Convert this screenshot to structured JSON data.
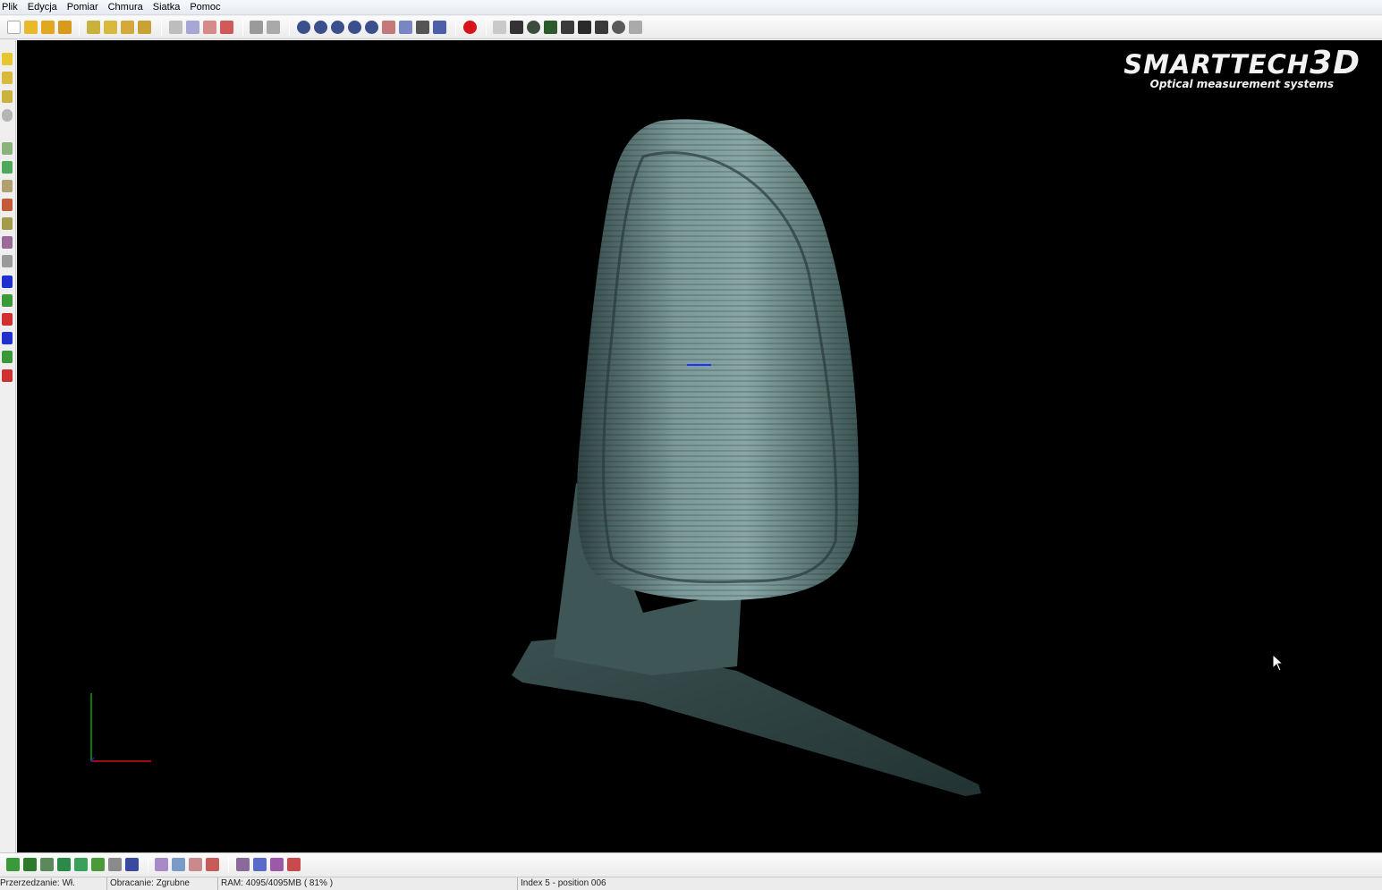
{
  "menu": [
    "Plik",
    "Edycja",
    "Pomiar",
    "Chmura",
    "Siatka",
    "Pomoc"
  ],
  "logo": {
    "brand": "SMARTTECH",
    "brand_suffix": "3D",
    "tagline": "Optical measurement systems"
  },
  "icons": {
    "top_toolbar": [
      "new-file-icon",
      "open-icon",
      "save-icon",
      "save-as-icon",
      "import-icon",
      "export-icon",
      "scan-icon",
      "merge-icon",
      "grid-select-icon",
      "rotate-select-icon",
      "select-all-icon",
      "delete-icon",
      "undo-icon",
      "redo-icon",
      "view-front-icon",
      "view-back-icon",
      "view-left-icon",
      "view-right-icon",
      "view-top-icon",
      "view-bottom-icon",
      "view-iso-icon",
      "perspective-icon",
      "zoom-fit-icon",
      "stop-icon",
      "power-icon",
      "camera-icon",
      "projector-icon",
      "calibrate-icon",
      "settings-icon",
      "film-icon",
      "network-icon",
      "sensor-icon"
    ],
    "left_toolbar": [
      "layer-icon",
      "layer-list-icon",
      "layer-edit-icon",
      "help-icon",
      "measure-point-icon",
      "measure-distance-icon",
      "measure-angle-icon",
      "measure-plane-icon",
      "measure-circle-icon",
      "measure-cylinder-icon",
      "measure-sphere-icon",
      "box-blue-icon",
      "box-wire-icon",
      "box-red-icon",
      "box-blue-2-icon",
      "box-wire-2-icon",
      "box-red-2-icon"
    ],
    "bottom_toolbar": [
      "mesh-green-icon",
      "mesh-smooth-icon",
      "mesh-filter-icon",
      "mesh-fill-icon",
      "mesh-decimate-icon",
      "mesh-arrow-icon",
      "mesh-cut-icon",
      "mesh-color-icon",
      "cloud-select-icon",
      "cloud-rotate-icon",
      "cloud-grid-icon",
      "cloud-delete-icon",
      "tri-a-icon",
      "tri-rotate-icon",
      "tri-x-icon",
      "tri-delete-icon"
    ]
  },
  "status": {
    "rendering": "Przerzedzanie: Wł.",
    "rotation": "Obracanie: Zgrubne",
    "ram": "RAM: 4095/4095MB  ( 81% )",
    "index": "Index 5 - position 006"
  },
  "colors": {
    "viewport_bg": "#000000",
    "scan_color": "#6f8f8f",
    "axis_x": "#d01010",
    "axis_y": "#10a010",
    "axis_z": "#1020d0",
    "stop_button": "#d8141a"
  }
}
